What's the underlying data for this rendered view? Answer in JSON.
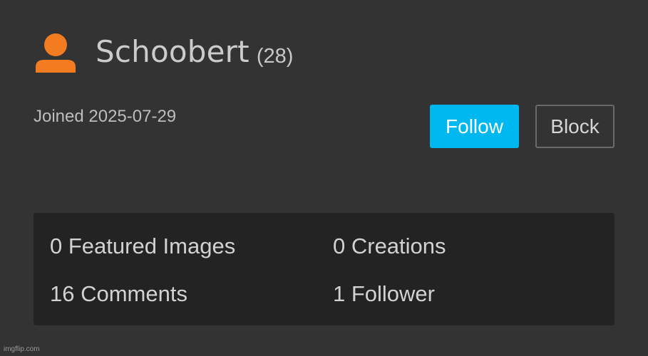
{
  "profile": {
    "username": "Schoobert",
    "points": "(28)",
    "joined": "Joined 2025-07-29",
    "avatar_icon": "user-silhouette-icon",
    "avatar_color": "#f47c20"
  },
  "actions": {
    "follow_label": "Follow",
    "block_label": "Block",
    "follow_color": "#00b8f0"
  },
  "stats": {
    "featured_images": "0 Featured Images",
    "creations": "0 Creations",
    "comments": "16 Comments",
    "followers": "1 Follower"
  },
  "watermark": "imgflip.com"
}
